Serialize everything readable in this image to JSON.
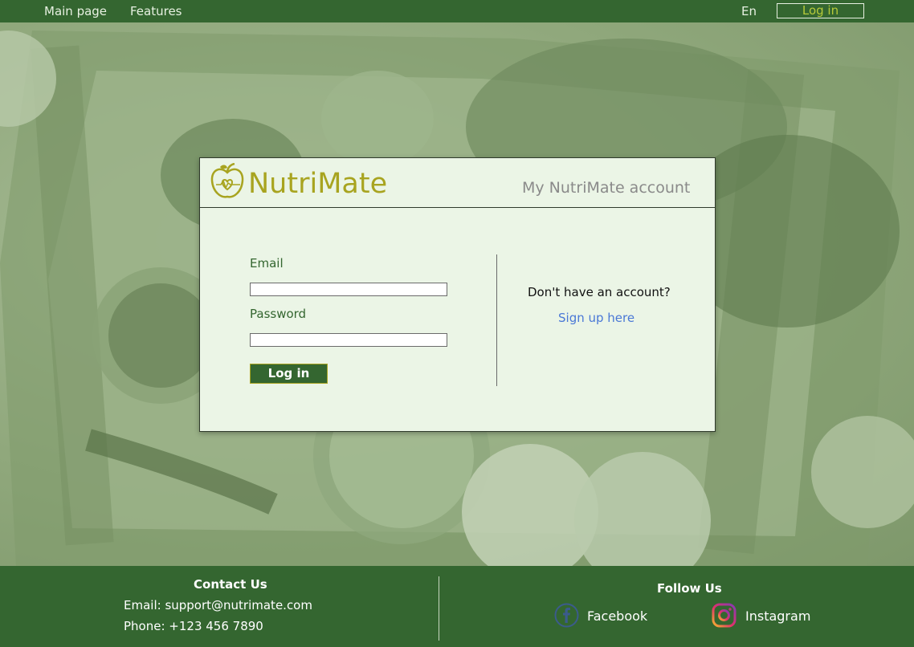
{
  "nav": {
    "main_page": "Main page",
    "features": "Features",
    "language": "En",
    "login": "Log in"
  },
  "card": {
    "brand": "NutriMate",
    "account_title": "My NutriMate account",
    "email_label": "Email",
    "email_value": "",
    "password_label": "Password",
    "password_value": "",
    "login_button": "Log in",
    "no_account": "Don't have an account?",
    "signup_link": "Sign up here"
  },
  "footer": {
    "contact_title": "Contact Us",
    "email_line": "Email: support@nutrimate.com",
    "phone_line": "Phone: +123 456 7890",
    "follow_title": "Follow Us",
    "facebook": "Facebook",
    "instagram": "Instagram"
  },
  "colors": {
    "nav_bg": "#346630",
    "card_bg": "#ebf5e6",
    "brand": "#a8a420",
    "link": "#4a78d6"
  },
  "icons": [
    "apple-heart-logo-icon",
    "facebook-icon",
    "instagram-icon"
  ]
}
